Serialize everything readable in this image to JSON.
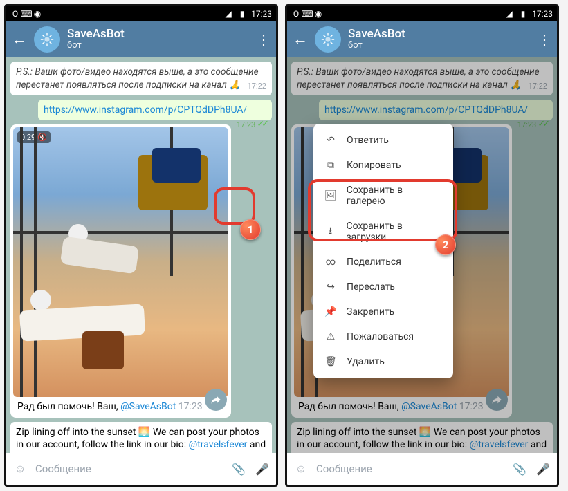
{
  "statusbar": {
    "time": "17:23",
    "icons": {
      "opera": "O",
      "keyboard": "⌨",
      "shazam": "◉",
      "signal": "◢",
      "battery": "▮"
    }
  },
  "appbar": {
    "back_icon": "←",
    "title": "SaveAsBot",
    "subtitle": "бот",
    "more_icon": "⋮"
  },
  "messages": {
    "ps_text": "P.S.: Ваши фото/видео находятся выше, а это сообщение перестанет появляться после подписки на канал 🙏",
    "ps_time": "17:22",
    "link_url": "https://www.instagram.com/p/CPTQdDPh8UA/",
    "link_time": "17:23",
    "video_duration": "0:29",
    "mute_icon": "🔇",
    "caption_prefix": "Рад был помочь! Ваш, ",
    "caption_mention": "@SaveAsBot",
    "caption_time": "17:23",
    "zip_prefix": "Zip lining off into the sunset 🌅 We can post your photos in our account, follow the link in our bio: ",
    "zip_mention": "@travelsfever",
    "zip_suffix": " and we will select your pictures"
  },
  "inputbar": {
    "placeholder": "Сообщение",
    "emoji_icon": "☺",
    "attach_icon": "📎",
    "mic_icon": "🎤"
  },
  "context_menu": {
    "items": [
      {
        "icon": "↶",
        "label": "Ответить"
      },
      {
        "icon": "⧉",
        "label": "Копировать"
      },
      {
        "icon": "🖼",
        "label": "Сохранить в галерею"
      },
      {
        "icon": "⭳",
        "label": "Сохранить в загрузки"
      },
      {
        "icon": "∞",
        "label": "Поделиться"
      },
      {
        "icon": "↪",
        "label": "Переслать"
      },
      {
        "icon": "📌",
        "label": "Закрепить"
      },
      {
        "icon": "⚠",
        "label": "Пожаловаться"
      },
      {
        "icon": "🗑",
        "label": "Удалить"
      }
    ]
  },
  "callouts": {
    "one": "1",
    "two": "2"
  }
}
